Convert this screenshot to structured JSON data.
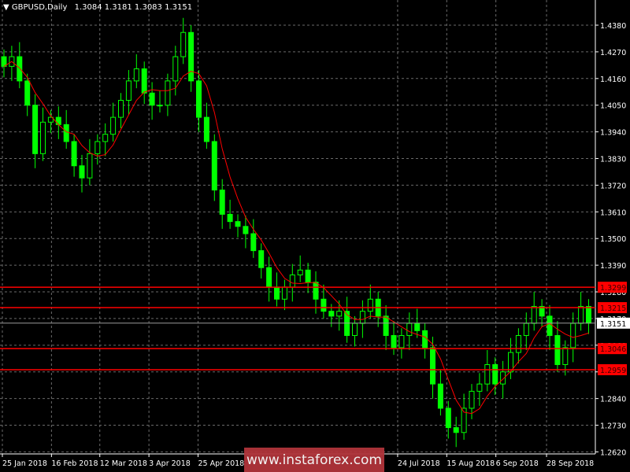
{
  "header": {
    "symbol": "GBPUSD,Daily",
    "ohlc": "1.3084 1.3181 1.3083 1.3151"
  },
  "watermark": "www.instaforex.com",
  "colors": {
    "bg": "#000000",
    "bull": "#00ff00",
    "ma": "#ff0000",
    "level": "#ff0000",
    "grid": "#777777",
    "axis": "#ffffff"
  },
  "chart_data": {
    "type": "candlestick",
    "title": "GBPUSD,Daily",
    "ylim": [
      1.2585,
      1.4445
    ],
    "y_ticks": [
      "1.4380",
      "1.4270",
      "1.4160",
      "1.4050",
      "1.3940",
      "1.3830",
      "1.3720",
      "1.3610",
      "1.3500",
      "1.3390",
      "1.3280",
      "1.3170",
      "1.3060",
      "1.2950",
      "1.2840",
      "1.2730",
      "1.2620"
    ],
    "x_labels": [
      {
        "label": "25 Jan 2018",
        "index": 0
      },
      {
        "label": "16 Feb 2018",
        "index": 6.3
      },
      {
        "label": "12 Mar 2018",
        "index": 12.5
      },
      {
        "label": "3 Apr 2018",
        "index": 18.8
      },
      {
        "label": "25 Apr 2018",
        "index": 25.1
      },
      {
        "label": "24 Jul 2018",
        "index": 50.7
      },
      {
        "label": "15 Aug 2018",
        "index": 57.0
      },
      {
        "label": "6 Sep 2018",
        "index": 63.3
      },
      {
        "label": "28 Sep 2018",
        "index": 69.8
      }
    ],
    "closes": [
      1.421,
      1.425,
      1.415,
      1.405,
      1.385,
      1.398,
      1.4,
      1.397,
      1.39,
      1.38,
      1.375,
      1.385,
      1.39,
      1.393,
      1.4,
      1.407,
      1.415,
      1.42,
      1.41,
      1.405,
      1.405,
      1.415,
      1.425,
      1.435,
      1.415,
      1.4,
      1.39,
      1.37,
      1.36,
      1.357,
      1.355,
      1.352,
      1.345,
      1.338,
      1.33,
      1.325,
      1.33,
      1.335,
      1.337,
      1.332,
      1.325,
      1.32,
      1.318,
      1.32,
      1.31,
      1.315,
      1.32,
      1.325,
      1.318,
      1.31,
      1.305,
      1.31,
      1.315,
      1.312,
      1.305,
      1.29,
      1.28,
      1.272,
      1.27,
      1.28,
      1.287,
      1.29,
      1.298,
      1.29,
      1.295,
      1.303,
      1.31,
      1.315,
      1.322,
      1.318,
      1.31,
      1.298,
      1.305,
      1.315,
      1.322,
      1.3151
    ],
    "moving_average": {
      "period": 5,
      "color": "#ff0000"
    },
    "levels": [
      {
        "value": "1.3299",
        "color": "#ff0000"
      },
      {
        "value": "1.3215",
        "color": "#ff0000"
      },
      {
        "value": "1.3046",
        "color": "#ff0000"
      },
      {
        "value": "1.2959",
        "color": "#ff0000"
      }
    ],
    "current_price": "1.3151"
  }
}
